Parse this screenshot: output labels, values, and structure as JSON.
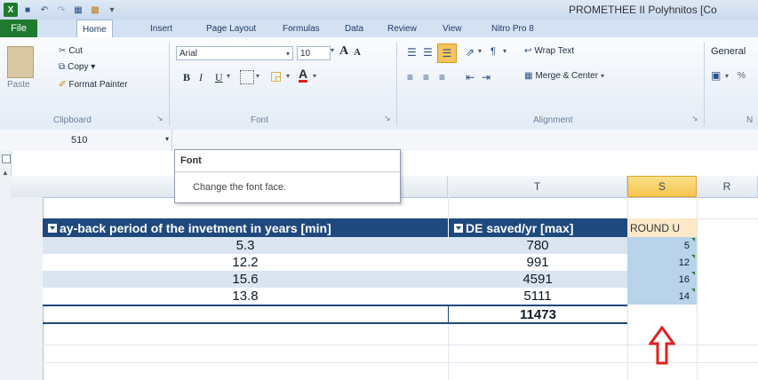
{
  "title": {
    "text": "PROMETHEE II Polyhnitos [Co"
  },
  "tabs": {
    "file": "File",
    "home": "Home",
    "insert": "Insert",
    "page_layout": "Page Layout",
    "formulas": "Formulas",
    "data": "Data",
    "review": "Review",
    "view": "View",
    "nitro": "Nitro Pro 8"
  },
  "clipboard": {
    "paste": "Paste",
    "cut": "Cut",
    "copy": "Copy ▾",
    "format_painter": "Format Painter",
    "label": "Clipboard"
  },
  "font": {
    "name": "Arial",
    "size": "10",
    "label": "Font",
    "bold": "B",
    "italic": "I",
    "underline": "U",
    "grow": "A",
    "shrink": "A",
    "color": "A"
  },
  "alignment": {
    "wrap": "Wrap Text",
    "merge": "Merge & Center",
    "label": "Alignment"
  },
  "number": {
    "format": "General",
    "label": "N"
  },
  "namebox": {
    "value": "510"
  },
  "tooltip": {
    "title": "Font",
    "body": "Change the font face."
  },
  "columns": {
    "t": "T",
    "s": "S",
    "r": "R"
  },
  "table": {
    "header_a": "ay-back period of the invetment in years [min]",
    "header_b": "DE saved/yr [max]",
    "header_c": "ROUND U",
    "rows": [
      {
        "a": "5.3",
        "b": "780",
        "c": "5"
      },
      {
        "a": "12.2",
        "b": "991",
        "c": "12"
      },
      {
        "a": "15.6",
        "b": "4591",
        "c": "16"
      },
      {
        "a": "13.8",
        "b": "5111",
        "c": "14"
      }
    ],
    "total": "11473"
  },
  "colors": {
    "header_bg": "#1f497d",
    "band": "#dbe5f1",
    "accent_arrow": "#e02020",
    "file_tab": "#1f7a2f"
  }
}
